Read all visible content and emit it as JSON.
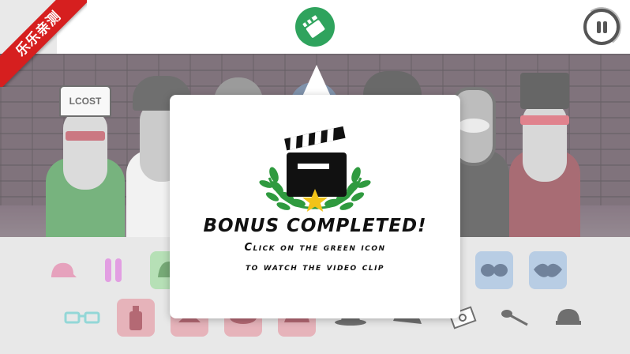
{
  "ribbon": {
    "text": "乐乐亲测"
  },
  "topbar": {
    "clip_icon": "film-clip-icon",
    "pause_icon": "pause-icon"
  },
  "stage": {
    "characters": [
      {
        "name": "char-1",
        "hat_text": "LCOST",
        "accent": "#2f8a3a"
      },
      {
        "name": "char-2",
        "accent": "#333333"
      },
      {
        "name": "char-3",
        "accent": "#555555"
      },
      {
        "name": "char-4",
        "accent": "#3d5a80"
      },
      {
        "name": "char-5",
        "accent": "#222222"
      },
      {
        "name": "char-6",
        "accent": "#444444"
      },
      {
        "name": "char-7",
        "accent": "#7a1e2a"
      }
    ]
  },
  "dialog": {
    "title": "BONUS COMPLETED!",
    "line1": "Click on the green icon",
    "line2": "to watch the video clip",
    "badge_icon": "clapperboard-laurel-star-icon"
  },
  "palette": {
    "items": [
      {
        "icon": "cap-icon",
        "color": "#c04a7a"
      },
      {
        "icon": "bars-icon",
        "color": "#c04ac0"
      },
      {
        "icon": "green-hat-icon",
        "color": "#3a9a3a"
      },
      {
        "icon": "blue-goggles-icon",
        "color": "#2f6fb0"
      },
      {
        "icon": "blue-lips-icon",
        "color": "#2f6fb0"
      },
      {
        "icon": "glasses-icon",
        "color": "#3fb3b3"
      },
      {
        "icon": "spray-can-icon",
        "color": "#b3263a"
      },
      {
        "icon": "red-item-icon",
        "color": "#b3263a"
      },
      {
        "icon": "red-bowl-icon",
        "color": "#b3263a"
      },
      {
        "icon": "red-cap-icon",
        "color": "#b3263a"
      },
      {
        "icon": "black-hat-icon",
        "color": "#222222"
      },
      {
        "icon": "black-cap-icon",
        "color": "#222222"
      },
      {
        "icon": "money-icon",
        "color": "#222222"
      },
      {
        "icon": "brush-icon",
        "color": "#222222"
      },
      {
        "icon": "helmet-icon",
        "color": "#222222"
      }
    ]
  }
}
